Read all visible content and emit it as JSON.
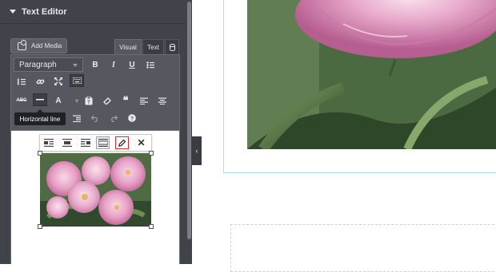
{
  "panel": {
    "section_title": "Text Editor",
    "add_media_label": "Add Media",
    "tabs": {
      "visual": "Visual",
      "text": "Text"
    },
    "toolbar": {
      "format_select_value": "Paragraph",
      "bold": "B",
      "italic": "I",
      "underline": "U",
      "abc": "ABC",
      "text_color": "A",
      "quote": "❝",
      "tooltip": "Horizontal line"
    }
  },
  "image_toolbar": {
    "close": "✕"
  },
  "colors": {
    "panel_bg": "#404349",
    "toolbar_bg": "#55585e",
    "edit_highlight": "#d9302e",
    "canvas_border": "#a8e0ea"
  },
  "icons": [
    "caret-down-icon",
    "add-media-icon",
    "database-icon",
    "bold-icon",
    "italic-icon",
    "underline-icon",
    "bullet-list-icon",
    "numbered-list-icon",
    "link-icon",
    "fullscreen-icon",
    "keyboard-icon",
    "strikethrough-icon",
    "horizontal-line-icon",
    "text-color-icon",
    "paste-text-icon",
    "clear-format-icon",
    "blockquote-icon",
    "align-left-icon",
    "align-center-icon",
    "indent-icon",
    "undo-icon",
    "redo-icon",
    "help-icon",
    "align-image-left-icon",
    "align-image-center-icon",
    "align-image-right-icon",
    "no-align-icon",
    "pencil-icon",
    "close-icon",
    "chevron-left-icon"
  ]
}
